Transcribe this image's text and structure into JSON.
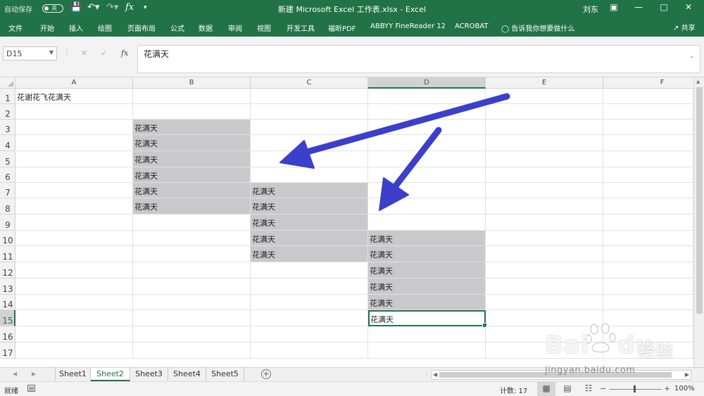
{
  "titlebar": {
    "autosave_label": "自动保存",
    "autosave_state": "关",
    "window_title": "新建 Microsoft Excel 工作表.xlsx  -  Excel",
    "user_name": "刘东"
  },
  "ribbon": {
    "tabs": [
      "文件",
      "开始",
      "插入",
      "绘图",
      "页面布局",
      "公式",
      "数据",
      "审阅",
      "视图",
      "开发工具",
      "福昕PDF",
      "ABBYY FineReader 12",
      "ACROBAT"
    ],
    "tell_me": "告诉我你想要做什么",
    "share": "共享"
  },
  "formula_bar": {
    "name_box": "D15",
    "formula": "花满天"
  },
  "grid": {
    "columns": [
      "A",
      "B",
      "C",
      "D",
      "E",
      "F"
    ],
    "active_column": "D",
    "rows": [
      "1",
      "2",
      "3",
      "4",
      "5",
      "6",
      "7",
      "8",
      "9",
      "10",
      "11",
      "12",
      "13",
      "14",
      "15",
      "16",
      "17"
    ],
    "active_row": "15",
    "cells": {
      "A1": "花谢花飞花满天",
      "B3": "花满天",
      "B4": "花满天",
      "B5": "花满天",
      "B6": "花满天",
      "B7": "花满天",
      "B8": "花满天",
      "C7": "花满天",
      "C8": "花满天",
      "C9": "花满天",
      "C10": "花满天",
      "C11": "花满天",
      "D10": "花满天",
      "D11": "花满天",
      "D12": "花满天",
      "D13": "花满天",
      "D14": "花满天",
      "D15": "花满天"
    },
    "filled_cells": [
      "B3",
      "B4",
      "B5",
      "B6",
      "B7",
      "B8",
      "C7",
      "C8",
      "C9",
      "C10",
      "C11",
      "D10",
      "D11",
      "D12",
      "D13",
      "D14"
    ],
    "active_cell": "D15"
  },
  "sheets": {
    "tabs": [
      "Sheet1",
      "Sheet2",
      "Sheet3",
      "Sheet4",
      "Sheet5"
    ],
    "active": "Sheet2"
  },
  "statusbar": {
    "ready": "就绪",
    "count": "计数: 17",
    "zoom": "100%"
  },
  "watermark": {
    "brand": "Bai",
    "brand_suffix": "du",
    "brand_cn": "经验",
    "site": "jingyan.baidu.com"
  },
  "colors": {
    "excel_green": "#217346",
    "selection_fill": "#c9c8ca",
    "arrow": "#3b3fc9"
  }
}
